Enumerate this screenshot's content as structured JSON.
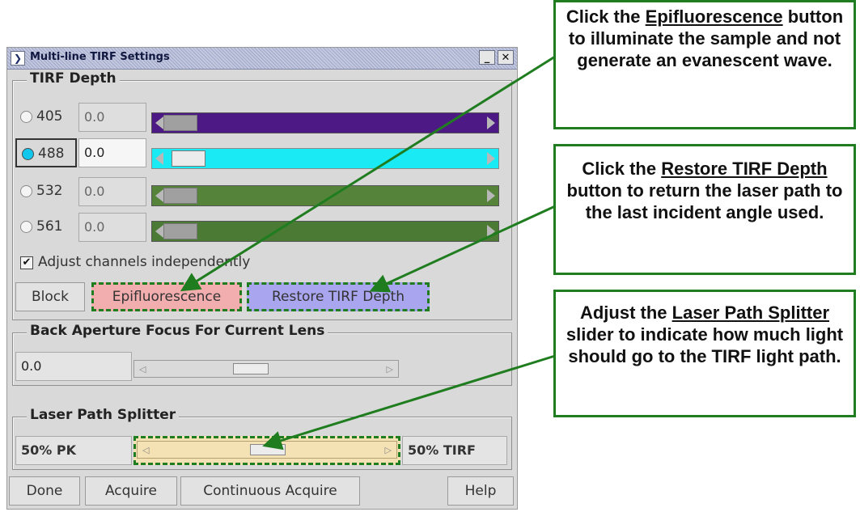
{
  "window": {
    "title": "Multi-line TIRF Settings",
    "menu_glyph": "❯",
    "minimize_glyph": "_",
    "close_glyph": "✕"
  },
  "tirf_depth": {
    "label": "TIRF Depth",
    "channels": [
      {
        "wavelength": "405",
        "value": "0.0",
        "selected": false,
        "color": "#4d1a85"
      },
      {
        "wavelength": "488",
        "value": "0.0",
        "selected": true,
        "color": "#19eaf3"
      },
      {
        "wavelength": "532",
        "value": "0.0",
        "selected": false,
        "color": "#55833a"
      },
      {
        "wavelength": "561",
        "value": "0.0",
        "selected": false,
        "color": "#4a7a34"
      }
    ],
    "adjust_label": "Adjust channels independently",
    "adjust_checked": true,
    "buttons": {
      "block": "Block",
      "epi": "Epifluorescence",
      "restore": "Restore TIRF Depth"
    }
  },
  "back_aperture": {
    "label": "Back Aperture Focus For Current Lens",
    "value": "0.0"
  },
  "laser_splitter": {
    "label": "Laser Path Splitter",
    "left_value": "50% PK",
    "right_value": "50% TIRF",
    "fraction": 0.5
  },
  "footer": {
    "done": "Done",
    "acquire": "Acquire",
    "continuous": "Continuous Acquire",
    "help": "Help"
  },
  "annotations": {
    "epi": {
      "p1": "Click the ",
      "u1": "Epifluorescence",
      "p2": " button to illuminate the sample and not generate an evanescent wave."
    },
    "restore": {
      "p1": "Click the ",
      "u1": "Restore TIRF Depth",
      "p2": " button to return the laser path to the last incident angle used."
    },
    "splitter": {
      "p1": "Adjust the ",
      "u1": "Laser Path Splitter",
      "p2": " slider to indicate how much light should go to the TIRF light path."
    }
  },
  "colors": {
    "annotation_green": "#1f7d1f",
    "epi_button": "#f2aeae",
    "restore_button": "#a9a6ef",
    "splitter_highlight": "#f5e2b4"
  }
}
